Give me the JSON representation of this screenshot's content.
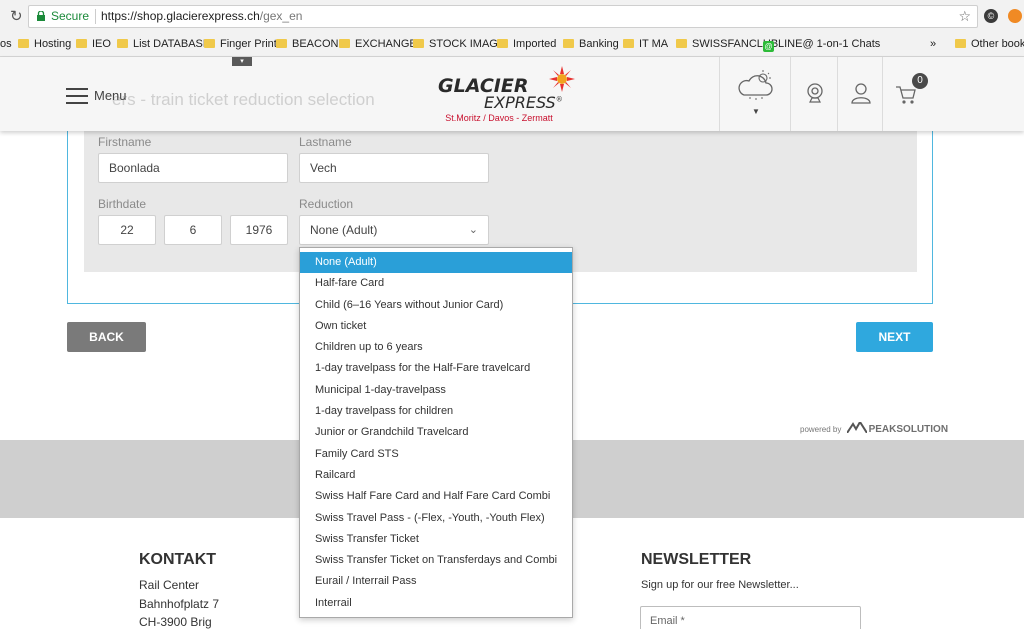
{
  "browser": {
    "secure_label": "Secure",
    "url_host": "https://shop.glacierexpress.ch",
    "url_path": "/gex_en"
  },
  "bookmarks": [
    {
      "label": "os",
      "icon": "none"
    },
    {
      "label": "Hosting",
      "icon": "folder-icon"
    },
    {
      "label": "IEO",
      "icon": "folder-icon"
    },
    {
      "label": "List DATABASE",
      "icon": "folder-icon"
    },
    {
      "label": "Finger Print",
      "icon": "folder-icon"
    },
    {
      "label": "BEACON",
      "icon": "folder-icon"
    },
    {
      "label": "EXCHANGE",
      "icon": "folder-icon"
    },
    {
      "label": "STOCK IMAGE",
      "icon": "folder-icon"
    },
    {
      "label": "Imported",
      "icon": "folder-icon"
    },
    {
      "label": "Banking",
      "icon": "folder-icon"
    },
    {
      "label": "IT MA",
      "icon": "folder-icon"
    },
    {
      "label": "SWISSFANCLUB",
      "icon": "folder-icon"
    },
    {
      "label": "LINE@ 1-on-1 Chats",
      "icon": "line-icon"
    },
    {
      "label": "»",
      "icon": "none"
    },
    {
      "label": "Other bookm",
      "icon": "folder-icon"
    }
  ],
  "header": {
    "menu_label": "Menu",
    "ghost_title": "ers - train ticket reduction selection",
    "logo_line1": "GLACIER",
    "logo_line2": "EXPRESS",
    "logo_tagline": "St.Moritz / Davos - Zermatt",
    "cart_count": "0"
  },
  "form": {
    "firstname_label": "Firstname",
    "firstname_value": "Boonlada",
    "lastname_label": "Lastname",
    "lastname_value": "Vech",
    "birthdate_label": "Birthdate",
    "birth_day": "22",
    "birth_month": "6",
    "birth_year": "1976",
    "reduction_label": "Reduction",
    "reduction_value": "None (Adult)"
  },
  "buttons": {
    "back": "BACK",
    "next": "NEXT"
  },
  "powered": {
    "prefix": "powered by",
    "brand": "PEAKSOLUTION"
  },
  "reduction_options": [
    "None (Adult)",
    "Half-fare Card",
    "Child (6–16 Years without Junior Card)",
    "Own ticket",
    "Children up to 6 years",
    "1-day travelpass for the Half-Fare travelcard",
    "Municipal 1-day-travelpass",
    "1-day travelpass for children",
    "Junior or Grandchild Travelcard",
    "Family Card STS",
    "Railcard",
    "Swiss Half Fare Card and Half Fare Card Combi",
    "Swiss Travel Pass - (-Flex, -Youth, -Youth Flex)",
    "Swiss Transfer Ticket",
    "Swiss Transfer Ticket on Transferdays and Combi",
    "Eurail / Interrail Pass",
    "Interrail"
  ],
  "selected_option_index": 0,
  "footer": {
    "kontakt_title": "KONTAKT",
    "kontakt_lines": [
      "Rail Center",
      "Bahnhofplatz 7",
      "CH-3900 Brig"
    ],
    "newsletter_title": "NEWSLETTER",
    "newsletter_sub": "Sign up for our free Newsletter...",
    "email_placeholder": "Email *"
  },
  "colors": {
    "accent": "#2fa8de",
    "selected_option": "#2a9fd8",
    "back_button": "#7a7a7a",
    "logo_red": "#c8102e",
    "secure_green": "#1b8a3a"
  }
}
